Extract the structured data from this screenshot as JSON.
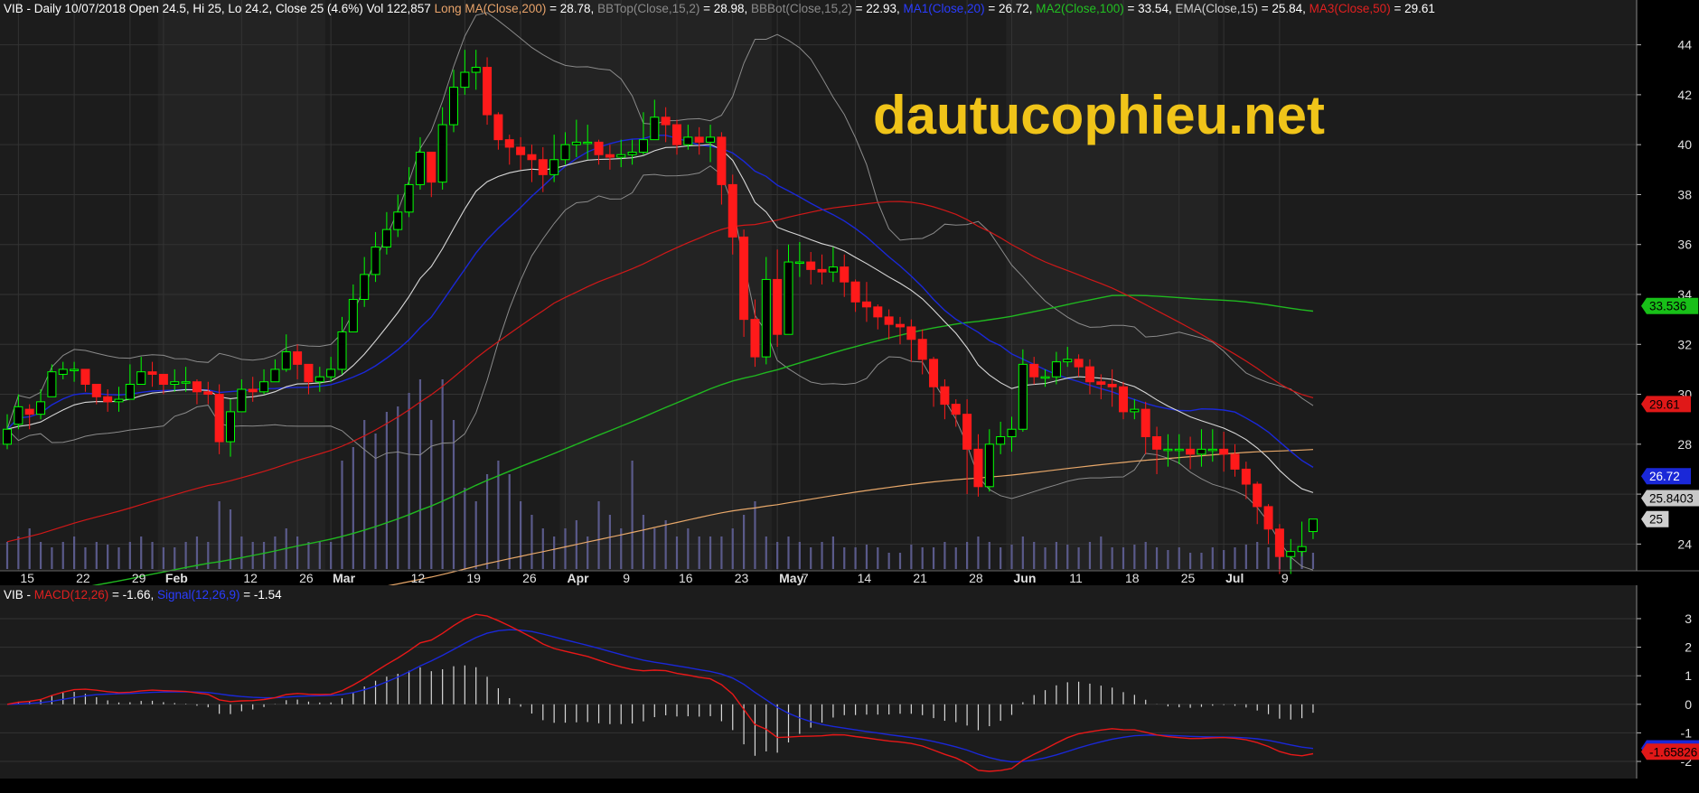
{
  "header": {
    "info_segments": [
      {
        "text": "VIB - Daily 10/07/2018 Open 24.5, Hi 25, Lo 24.2, Close 25 (4.6%) Vol 122,857 ",
        "color": "#ffffff"
      },
      {
        "text": "Long MA(Close,200)",
        "color": "#e8a36a"
      },
      {
        "text": " = 28.78, ",
        "color": "#ffffff"
      },
      {
        "text": "BBTop(Close,15,2)",
        "color": "#8a8a8a"
      },
      {
        "text": " = 28.98, ",
        "color": "#ffffff"
      },
      {
        "text": "BBBot(Close,15,2)",
        "color": "#8a8a8a"
      },
      {
        "text": " = 22.93, ",
        "color": "#ffffff"
      },
      {
        "text": "MA1(Close,20)",
        "color": "#2a3cff"
      },
      {
        "text": " = 26.72, ",
        "color": "#ffffff"
      },
      {
        "text": "MA2(Close,100)",
        "color": "#22c022"
      },
      {
        "text": " = 33.54, ",
        "color": "#ffffff"
      },
      {
        "text": "EMA(Close,15)",
        "color": "#cfcfcf"
      },
      {
        "text": " = 25.84, ",
        "color": "#ffffff"
      },
      {
        "text": "MA3(Close,50)",
        "color": "#e02020"
      },
      {
        "text": " = 29.61",
        "color": "#ffffff"
      }
    ],
    "macd_segments": [
      {
        "text": "VIB - ",
        "color": "#ffffff"
      },
      {
        "text": "MACD(12,26)",
        "color": "#e02020"
      },
      {
        "text": " = -1.66, ",
        "color": "#ffffff"
      },
      {
        "text": "Signal(12,26,9)",
        "color": "#2a3cff"
      },
      {
        "text": " = -1.54",
        "color": "#ffffff"
      }
    ]
  },
  "watermark": "dautucophieu.net",
  "colors": {
    "background": "#000000",
    "panel": "#1c1c1c",
    "grid": "#333333",
    "up": "#00ff00",
    "down": "#ff1a1a",
    "volume": "#5a5a8a",
    "bb": "#8a8a8a",
    "ema": "#d8d8d8",
    "ma20": "#1a28d8",
    "ma50": "#d01818",
    "ma100": "#20b820",
    "ma200": "#e8a86a",
    "macd": "#e81818",
    "signal": "#1a28d8",
    "watermark": "#f0c419"
  },
  "chart_data": [
    {
      "type": "candlestick",
      "ylim": [
        23,
        45
      ],
      "y_ticks": [
        24,
        26,
        28,
        30,
        32,
        34,
        36,
        38,
        40,
        42,
        44
      ],
      "x_ticks": [
        {
          "label": "15",
          "i": 1,
          "month": false
        },
        {
          "label": "22",
          "i": 6,
          "month": false
        },
        {
          "label": "29",
          "i": 11,
          "month": false
        },
        {
          "label": "Feb",
          "i": 14,
          "month": true
        },
        {
          "label": "12",
          "i": 21,
          "month": false
        },
        {
          "label": "26",
          "i": 26,
          "month": false
        },
        {
          "label": "Mar",
          "i": 29,
          "month": true
        },
        {
          "label": "12",
          "i": 36,
          "month": false
        },
        {
          "label": "19",
          "i": 41,
          "month": false
        },
        {
          "label": "26",
          "i": 46,
          "month": false
        },
        {
          "label": "Apr",
          "i": 50,
          "month": true
        },
        {
          "label": "9",
          "i": 55,
          "month": false
        },
        {
          "label": "16",
          "i": 60,
          "month": false
        },
        {
          "label": "23",
          "i": 65,
          "month": false
        },
        {
          "label": "May",
          "i": 69,
          "month": true
        },
        {
          "label": "7",
          "i": 71,
          "month": false
        },
        {
          "label": "14",
          "i": 76,
          "month": false
        },
        {
          "label": "21",
          "i": 81,
          "month": false
        },
        {
          "label": "28",
          "i": 86,
          "month": false
        },
        {
          "label": "Jun",
          "i": 90,
          "month": true
        },
        {
          "label": "11",
          "i": 95,
          "month": false
        },
        {
          "label": "18",
          "i": 100,
          "month": false
        },
        {
          "label": "25",
          "i": 105,
          "month": false
        },
        {
          "label": "Jul",
          "i": 109,
          "month": true
        },
        {
          "label": "9",
          "i": 114,
          "month": false
        }
      ],
      "right_labels": [
        {
          "text": "33.536",
          "value": 33.54,
          "bg": "#18c018",
          "fg": "#000000"
        },
        {
          "text": "29.61",
          "value": 29.61,
          "bg": "#e01818",
          "fg": "#000000"
        },
        {
          "text": "26.72",
          "value": 26.72,
          "bg": "#1a28d8",
          "fg": "#ffffff"
        },
        {
          "text": "25.8403",
          "value": 25.84,
          "bg": "#c8c8c8",
          "fg": "#000000"
        },
        {
          "text": "25",
          "value": 25.0,
          "bg": "#d0d0d0",
          "fg": "#000000"
        }
      ],
      "close": [
        28.6,
        29.5,
        29.2,
        29.7,
        30.9,
        31.0,
        31.0,
        30.4,
        29.9,
        29.7,
        29.8,
        30.4,
        30.9,
        30.8,
        30.4,
        30.5,
        30.5,
        30.1,
        30.0,
        28.1,
        29.3,
        30.2,
        30.1,
        30.5,
        31.0,
        31.7,
        31.2,
        30.5,
        30.7,
        31.0,
        32.5,
        33.8,
        34.8,
        35.9,
        36.6,
        37.3,
        38.4,
        39.7,
        38.5,
        40.8,
        42.3,
        42.9,
        43.1,
        41.2,
        40.2,
        39.9,
        39.6,
        39.4,
        38.8,
        39.4,
        40.0,
        40.1,
        40.1,
        39.6,
        39.5,
        39.6,
        39.7,
        40.2,
        41.1,
        40.8,
        40.0,
        40.3,
        40.1,
        40.3,
        38.4,
        36.3,
        33.0,
        31.5,
        34.6,
        32.4,
        35.3,
        35.3,
        35.0,
        34.9,
        35.1,
        34.5,
        33.7,
        33.5,
        33.1,
        32.8,
        32.7,
        32.2,
        31.4,
        30.3,
        29.6,
        29.2,
        27.8,
        26.3,
        28.0,
        28.3,
        28.6,
        31.2,
        30.7,
        30.7,
        31.3,
        31.4,
        31.1,
        30.5,
        30.4,
        30.3,
        29.3,
        29.4,
        28.3,
        27.8,
        27.8,
        27.8,
        27.6,
        27.8,
        27.8,
        27.6,
        27.0,
        26.4,
        25.5,
        24.6,
        23.5,
        23.7,
        23.9,
        25.0
      ],
      "high": [
        29.2,
        30.0,
        29.6,
        30.2,
        31.2,
        31.3,
        31.3,
        31.0,
        30.3,
        30.2,
        30.3,
        31.2,
        31.5,
        31.3,
        30.8,
        31.0,
        31.1,
        30.6,
        30.5,
        30.4,
        29.8,
        30.6,
        30.7,
        31.0,
        31.4,
        32.4,
        32.0,
        31.0,
        31.1,
        31.5,
        33.1,
        34.4,
        35.5,
        36.5,
        37.3,
        38.0,
        39.1,
        40.3,
        39.6,
        41.5,
        43.0,
        43.8,
        43.8,
        43.5,
        41.3,
        40.4,
        40.3,
        40.0,
        39.9,
        40.4,
        40.5,
        41.0,
        40.8,
        40.2,
        40.0,
        40.2,
        40.2,
        41.3,
        41.8,
        41.5,
        41.0,
        40.8,
        40.7,
        40.8,
        40.5,
        38.8,
        36.6,
        33.8,
        35.5,
        35.8,
        36.0,
        36.1,
        35.7,
        35.6,
        35.9,
        35.6,
        34.6,
        34.5,
        33.6,
        33.4,
        33.1,
        33.0,
        32.6,
        31.5,
        30.6,
        29.8,
        29.8,
        28.4,
        28.6,
        28.9,
        29.1,
        31.8,
        31.5,
        31.0,
        31.7,
        31.9,
        31.6,
        31.4,
        30.8,
        31.0,
        30.5,
        29.8,
        29.7,
        28.7,
        28.4,
        28.4,
        28.3,
        28.6,
        28.6,
        28.5,
        28.0,
        27.3,
        26.5,
        25.6,
        24.8,
        24.2,
        24.9,
        25.0
      ],
      "low": [
        27.8,
        28.6,
        28.6,
        29.0,
        30.1,
        30.6,
        30.5,
        30.1,
        29.6,
        29.3,
        29.3,
        29.8,
        30.5,
        30.3,
        30.0,
        30.1,
        30.1,
        29.6,
        29.6,
        27.6,
        27.5,
        29.6,
        29.7,
        30.0,
        30.5,
        30.9,
        30.6,
        30.0,
        30.1,
        30.5,
        30.8,
        32.6,
        33.5,
        34.5,
        35.6,
        36.3,
        37.1,
        38.2,
        37.9,
        38.2,
        40.5,
        42.0,
        42.2,
        40.8,
        39.8,
        39.2,
        39.0,
        38.5,
        38.1,
        38.5,
        39.2,
        39.5,
        39.4,
        39.2,
        39.0,
        39.1,
        39.2,
        39.6,
        40.4,
        40.1,
        39.6,
        39.8,
        39.6,
        39.3,
        37.6,
        35.6,
        32.3,
        31.1,
        31.2,
        31.9,
        33.1,
        34.7,
        34.4,
        34.4,
        34.5,
        33.9,
        33.3,
        32.9,
        32.6,
        32.2,
        32.0,
        31.3,
        30.8,
        29.5,
        29.0,
        28.7,
        26.0,
        25.9,
        26.1,
        27.6,
        27.7,
        28.5,
        30.4,
        30.3,
        30.4,
        31.1,
        30.7,
        30.0,
        29.8,
        29.5,
        29.0,
        29.0,
        27.6,
        26.8,
        27.1,
        27.2,
        27.0,
        27.1,
        27.3,
        26.9,
        26.7,
        25.8,
        24.8,
        24.0,
        22.8,
        22.8,
        23.5,
        24.2
      ],
      "open": [
        28.0,
        28.8,
        29.4,
        29.2,
        29.9,
        30.8,
        31.0,
        31.0,
        30.4,
        29.9,
        29.7,
        29.8,
        30.4,
        30.9,
        30.8,
        30.4,
        30.5,
        30.5,
        30.1,
        30.0,
        28.1,
        29.3,
        30.2,
        30.1,
        30.5,
        31.0,
        31.7,
        31.2,
        30.5,
        30.7,
        31.0,
        32.5,
        33.8,
        34.8,
        35.9,
        36.6,
        37.3,
        38.4,
        39.7,
        38.5,
        40.8,
        42.3,
        42.9,
        43.1,
        41.2,
        40.2,
        39.9,
        39.6,
        39.4,
        38.8,
        39.4,
        40.0,
        40.1,
        40.1,
        39.6,
        39.5,
        39.6,
        39.7,
        40.2,
        41.1,
        40.8,
        40.0,
        40.3,
        40.1,
        40.3,
        38.4,
        36.3,
        33.0,
        31.5,
        34.6,
        32.4,
        35.3,
        35.3,
        35.0,
        34.9,
        35.1,
        34.5,
        33.7,
        33.5,
        33.1,
        32.8,
        32.7,
        32.2,
        31.4,
        30.3,
        29.6,
        29.2,
        27.8,
        26.3,
        28.0,
        28.3,
        28.6,
        31.2,
        30.7,
        30.7,
        31.3,
        31.4,
        31.1,
        30.5,
        30.4,
        30.3,
        29.3,
        29.4,
        28.3,
        27.8,
        27.8,
        27.8,
        27.6,
        27.8,
        27.8,
        27.6,
        27.0,
        26.4,
        25.5,
        24.6,
        23.5,
        23.7,
        24.5
      ],
      "volume_scale": [
        0.1,
        0.12,
        0.15,
        0.1,
        0.08,
        0.1,
        0.12,
        0.08,
        0.1,
        0.09,
        0.08,
        0.1,
        0.12,
        0.1,
        0.08,
        0.08,
        0.1,
        0.12,
        0.1,
        0.25,
        0.22,
        0.12,
        0.1,
        0.1,
        0.12,
        0.15,
        0.12,
        0.1,
        0.1,
        0.1,
        0.4,
        0.45,
        0.55,
        0.5,
        0.58,
        0.6,
        0.65,
        0.7,
        0.55,
        0.7,
        0.55,
        0.3,
        0.25,
        0.35,
        0.4,
        0.35,
        0.25,
        0.2,
        0.15,
        0.12,
        0.15,
        0.18,
        0.12,
        0.25,
        0.2,
        0.15,
        0.4,
        0.2,
        0.15,
        0.18,
        0.12,
        0.15,
        0.12,
        0.12,
        0.12,
        0.15,
        0.2,
        0.25,
        0.12,
        0.1,
        0.12,
        0.1,
        0.08,
        0.1,
        0.12,
        0.08,
        0.08,
        0.09,
        0.08,
        0.06,
        0.06,
        0.09,
        0.08,
        0.08,
        0.1,
        0.08,
        0.1,
        0.12,
        0.1,
        0.08,
        0.09,
        0.12,
        0.1,
        0.08,
        0.1,
        0.09,
        0.08,
        0.1,
        0.12,
        0.08,
        0.08,
        0.09,
        0.1,
        0.08,
        0.07,
        0.08,
        0.06,
        0.06,
        0.08,
        0.07,
        0.08,
        0.09,
        0.1,
        0.08,
        0.07,
        0.06,
        0.07,
        0.06
      ]
    },
    {
      "type": "line",
      "ylim": [
        -2.6,
        3.6
      ],
      "y_ticks": [
        -2,
        -1,
        0,
        1,
        2,
        3
      ],
      "right_labels": [
        {
          "text": "-1.53657",
          "value": -1.54,
          "bg": "#1a28d8",
          "fg": "#ffffff"
        },
        {
          "text": "-1.65826",
          "value": -1.66,
          "bg": "#e01818",
          "fg": "#000000"
        }
      ]
    }
  ]
}
